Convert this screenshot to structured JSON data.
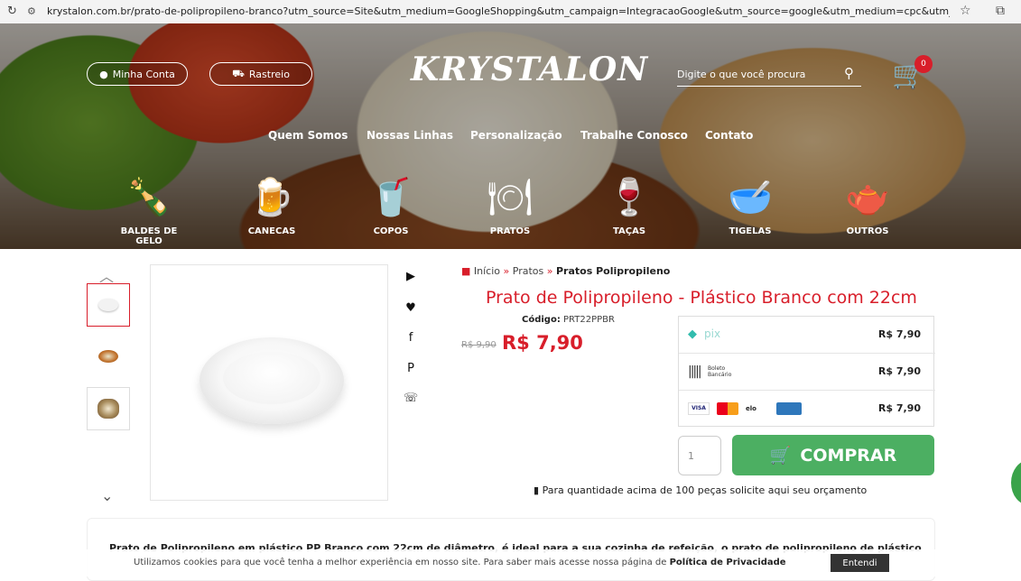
{
  "browser": {
    "url": "krystalon.com.br/prato-de-polipropileno-branco?utm_source=Site&utm_medium=GoogleShopping&utm_campaign=IntegracaoGoogle&utm_source=google&utm_medium=cpc&utm_campai...",
    "reload_icon": "reload-icon",
    "site_icon": "site-info-icon"
  },
  "header": {
    "account_label": "Minha Conta",
    "tracking_label": "Rastreio",
    "logo": "KRYSTALON",
    "search_placeholder": "Digite o que você procura",
    "cart_count": "0"
  },
  "nav": [
    "Quem Somos",
    "Nossas Linhas",
    "Personalização",
    "Trabalhe Conosco",
    "Contato"
  ],
  "categories": [
    {
      "label": "BALDES DE GELO",
      "icon": "ice-bucket-icon",
      "glyph": "🍾"
    },
    {
      "label": "CANECAS",
      "icon": "mug-icon",
      "glyph": "🍺"
    },
    {
      "label": "COPOS",
      "icon": "cup-icon",
      "glyph": "🥤"
    },
    {
      "label": "PRATOS",
      "icon": "plates-icon",
      "glyph": "🍽"
    },
    {
      "label": "TAÇAS",
      "icon": "wine-glass-icon",
      "glyph": "🍷"
    },
    {
      "label": "TIGELAS",
      "icon": "bowls-icon",
      "glyph": "🥣"
    },
    {
      "label": "OUTROS",
      "icon": "pitcher-icon",
      "glyph": "🫖"
    }
  ],
  "breadcrumb": {
    "home": "Início",
    "section": "Pratos",
    "current": "Pratos Polipropileno"
  },
  "product": {
    "title": "Prato de Polipropileno - Plástico Branco com 22cm",
    "code_label": "Código:",
    "code": "PRT22PPBR",
    "old_price": "R$ 9,90",
    "price": "R$ 7,90"
  },
  "payments": [
    {
      "method": "pix",
      "amount": "R$ 7,90"
    },
    {
      "method": "Boleto Bancário",
      "amount": "R$ 7,90"
    },
    {
      "method": "cards",
      "amount": "R$ 7,90"
    }
  ],
  "purchase": {
    "quantity_placeholder": "1",
    "buy_label": "COMPRAR",
    "quote_text": "Para quantidade acima de 100 peças solicite aqui seu orçamento"
  },
  "description_start": "Prato de Polipropileno em plástico PP Branco com 22cm de diâmetro, é ideal para a sua cozinha de refeição, o prato de polipropileno de plástico",
  "cookie": {
    "message": "Utilizamos cookies para que você tenha a melhor experiência em nosso site. Para saber mais acesse nossa página de ",
    "policy": "Política de Privacidade",
    "button": "Entendi"
  },
  "colors": {
    "accent": "#d81e2a",
    "buy": "#4caf62"
  }
}
